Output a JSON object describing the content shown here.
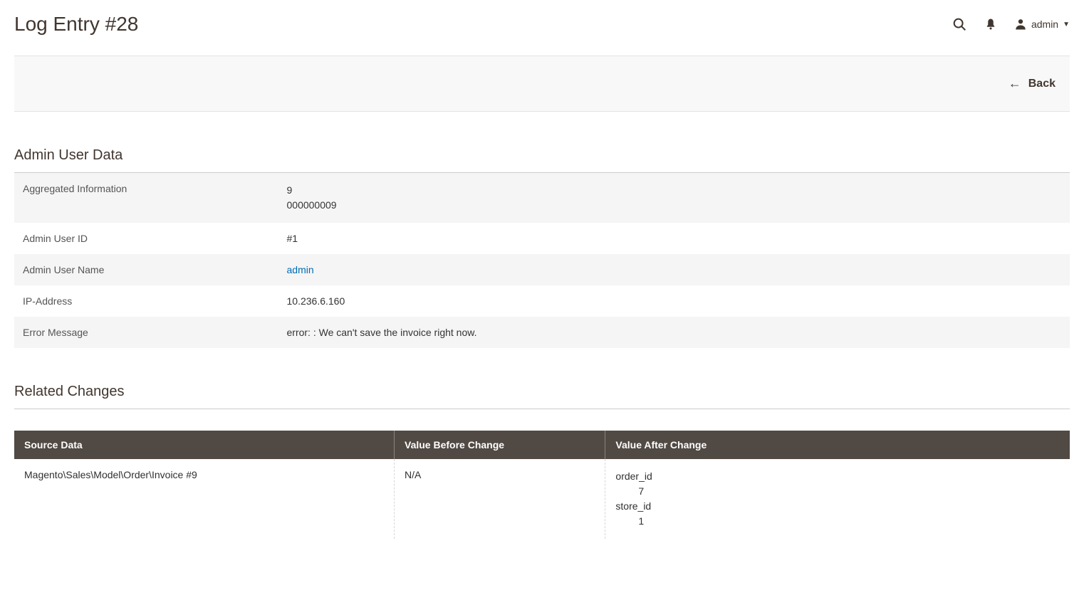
{
  "header": {
    "title": "Log Entry #28",
    "username": "admin"
  },
  "actions": {
    "back_label": "Back"
  },
  "admin_user_data": {
    "section_title": "Admin User Data",
    "rows": {
      "aggregated_label": "Aggregated Information",
      "aggregated_value": "9\n000000009",
      "user_id_label": "Admin User ID",
      "user_id_value": "#1",
      "user_name_label": "Admin User Name",
      "user_name_value": "admin",
      "ip_label": "IP-Address",
      "ip_value": "10.236.6.160",
      "error_label": "Error Message",
      "error_value": "error: : We can't save the invoice right now."
    }
  },
  "related_changes": {
    "section_title": "Related Changes",
    "columns": {
      "source": "Source Data",
      "before": "Value Before Change",
      "after": "Value After Change"
    },
    "row": {
      "source": "Magento\\Sales\\Model\\Order\\Invoice #9",
      "before": "N/A",
      "after": [
        {
          "k": "order_id",
          "v": "7"
        },
        {
          "k": "store_id",
          "v": "1"
        }
      ]
    }
  }
}
